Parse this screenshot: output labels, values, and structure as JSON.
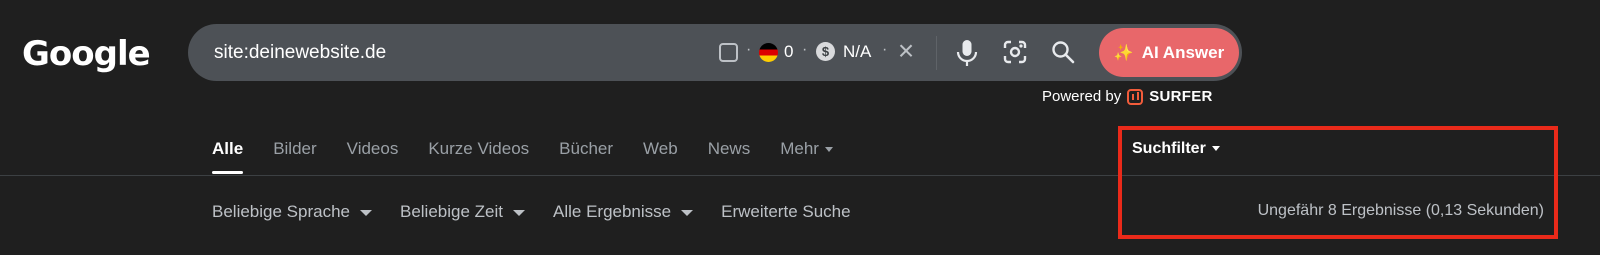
{
  "logo": {
    "text": "Google"
  },
  "search": {
    "query": "site:deinewebsite.de",
    "flag_count": "0",
    "dollar_symbol": "$",
    "cost": "N/A",
    "separator": "·",
    "clear_symbol": "×",
    "ai_button_label": "AI Answer"
  },
  "powered_by": {
    "text": "Powered by",
    "brand": "SURFER"
  },
  "tabs": [
    {
      "label": "Alle",
      "active": true
    },
    {
      "label": "Bilder"
    },
    {
      "label": "Videos"
    },
    {
      "label": "Kurze Videos"
    },
    {
      "label": "Bücher"
    },
    {
      "label": "Web"
    },
    {
      "label": "News"
    },
    {
      "label": "Mehr"
    }
  ],
  "suchfilter_label": "Suchfilter",
  "tools": [
    {
      "label": "Beliebige Sprache"
    },
    {
      "label": "Beliebige Zeit"
    },
    {
      "label": "Alle Ergebnisse"
    },
    {
      "label": "Erweiterte Suche"
    }
  ],
  "result_stats": "Ungefähr 8 Ergebnisse (0,13 Sekunden)",
  "colors": {
    "background": "#1f1f1f",
    "searchbar": "#4d5156",
    "ai_button": "#e8676a",
    "highlight_box": "#ea2a1a",
    "surfer_brand": "#f25c3b"
  },
  "icons": {
    "mic": "microphone-icon",
    "lens": "google-lens-icon",
    "search": "search-icon",
    "clear": "close-icon",
    "ai": "sparkle-icon"
  }
}
